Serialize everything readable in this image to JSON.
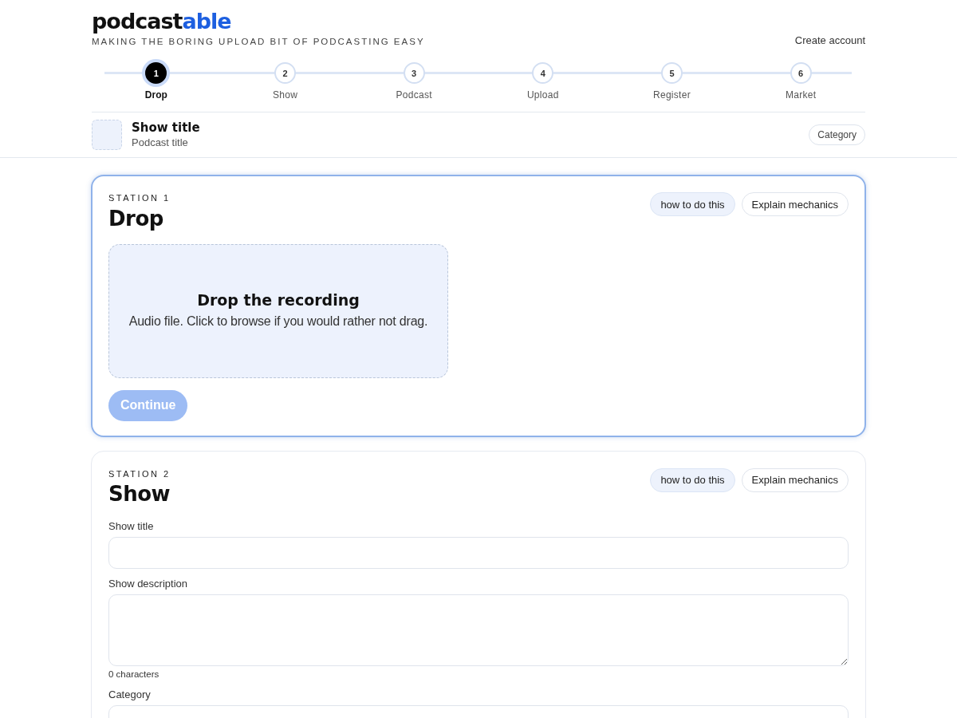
{
  "brand": {
    "name": "podcast",
    "accent": "able"
  },
  "tagline": "MAKING THE BORING UPLOAD BIT OF PODCASTING EASY",
  "nav_link": "Create account",
  "steps": [
    {
      "number": "1",
      "label": "Drop",
      "selected": true
    },
    {
      "number": "2",
      "label": "Show",
      "selected": false
    },
    {
      "number": "3",
      "label": "Podcast",
      "selected": false
    },
    {
      "number": "4",
      "label": "Upload",
      "selected": false
    },
    {
      "number": "5",
      "label": "Register",
      "selected": false
    },
    {
      "number": "6",
      "label": "Market",
      "selected": false
    }
  ],
  "show_summary": {
    "title": "Show title",
    "subtitle": "Podcast title",
    "category": "Category"
  },
  "stations": [
    {
      "kind": "drop",
      "kicker": "STATION 1",
      "title": "Drop",
      "active": true,
      "help_buttons": [
        "how to do this",
        "Explain mechanics"
      ],
      "dropzone": {
        "title": "Drop the recording",
        "hint": "Audio file. Click to browse if you would rather not drag."
      },
      "continue": {
        "label": "Continue",
        "disabled": true
      }
    },
    {
      "kind": "form",
      "kicker": "STATION 2",
      "title": "Show",
      "active": false,
      "help_buttons": [
        "how to do this",
        "Explain mechanics"
      ],
      "fields": [
        {
          "kind": "input",
          "label": "Show title"
        },
        {
          "kind": "textarea",
          "label": "Show description",
          "counter": "0 characters"
        },
        {
          "kind": "select",
          "label": "Category"
        }
      ]
    }
  ]
}
